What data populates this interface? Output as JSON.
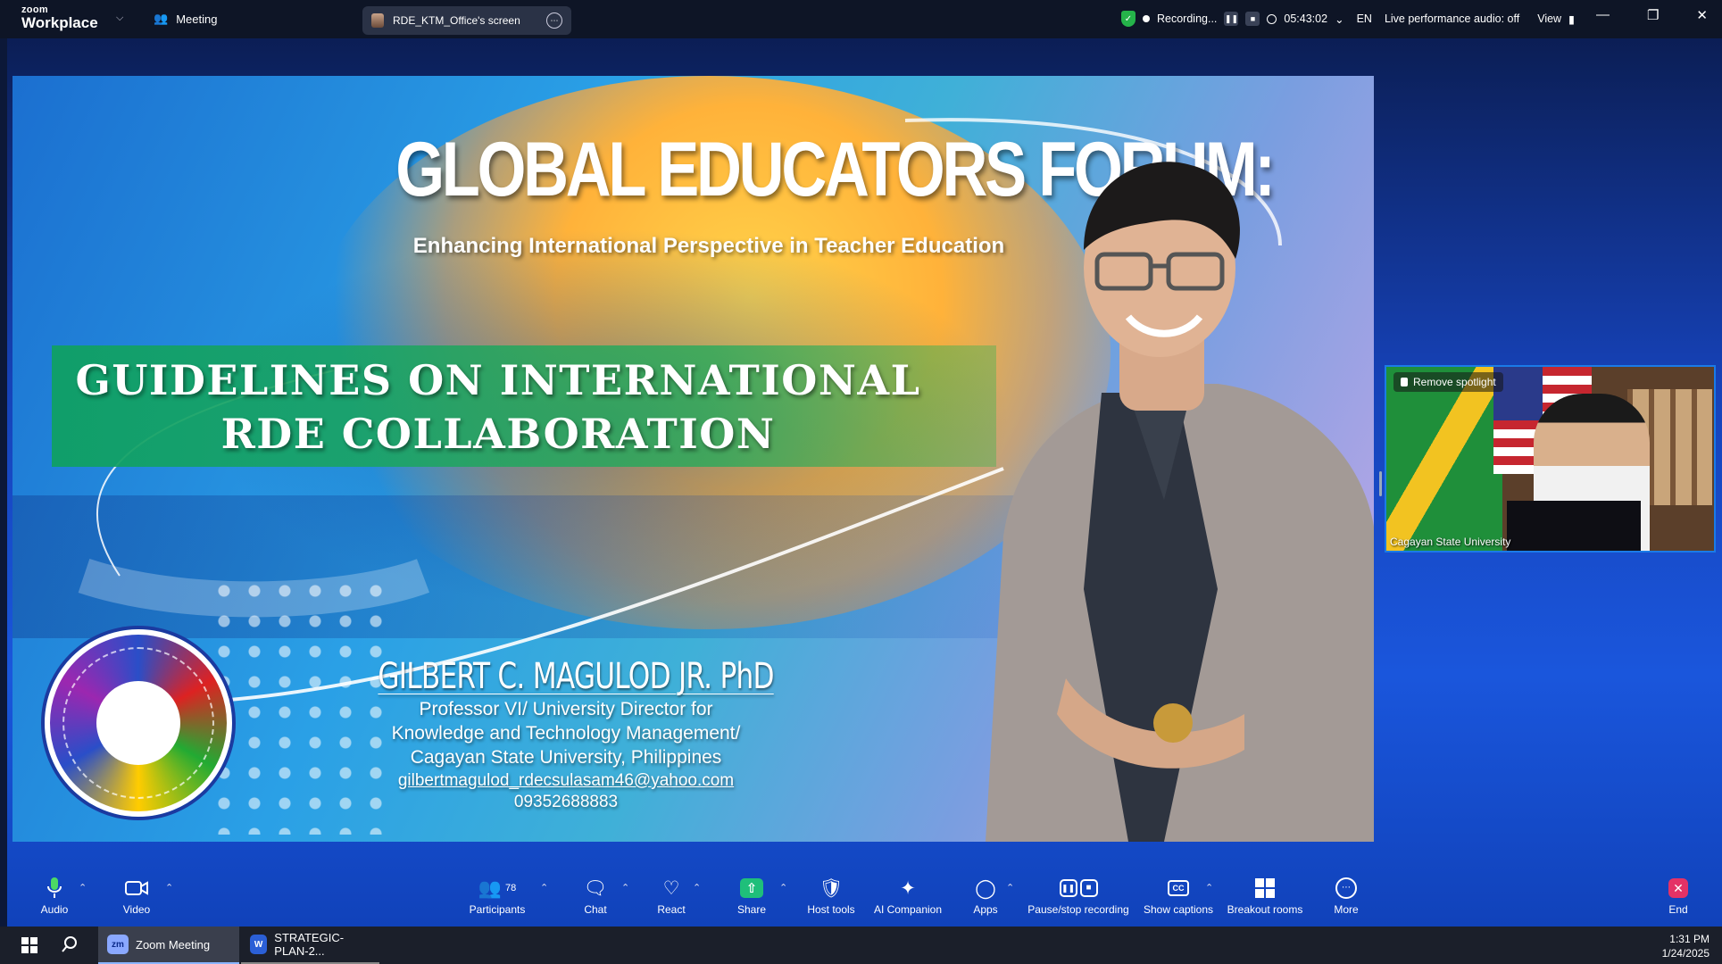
{
  "topbar": {
    "logo_line1": "zoom",
    "logo_line2": "Workplace",
    "meeting_label": "Meeting",
    "screen_share_label": "RDE_KTM_Office's screen",
    "recording_label": "Recording...",
    "timer": "05:43:02",
    "language": "EN",
    "performance": "Live performance audio: off",
    "view_label": "View"
  },
  "slide": {
    "title": "GLOBAL EDUCATORS FORUM:",
    "subtitle": "Enhancing International Perspective in Teacher Education",
    "topic_line1": "GUIDELINES ON INTERNATIONAL",
    "topic_line2": "RDE COLLABORATION",
    "speaker_name": "GILBERT C. MAGULOD JR. PhD",
    "speaker_role1": "Professor VI/ University Director for",
    "speaker_role2": "Knowledge and Technology Management/",
    "speaker_role3": "Cagayan State University, Philippines",
    "speaker_email": "gilbertmagulod_rdecsulasam46@yahoo.com",
    "speaker_phone": "09352688883"
  },
  "thumbnail": {
    "spotlight_label": "Remove spotlight",
    "participant_name": "Cagayan State University"
  },
  "toolbar": {
    "audio": "Audio",
    "video": "Video",
    "participants": "Participants",
    "participants_count": "78",
    "chat": "Chat",
    "react": "React",
    "share": "Share",
    "host_tools": "Host tools",
    "ai_companion": "AI Companion",
    "apps": "Apps",
    "pause_recording": "Pause/stop recording",
    "show_captions": "Show captions",
    "breakout_rooms": "Breakout rooms",
    "more": "More",
    "end": "End"
  },
  "taskbar": {
    "zoom_task": "Zoom Meeting",
    "word_task": "STRATEGIC-PLAN-2...",
    "time": "1:31 PM",
    "date": "1/24/2025"
  },
  "colors": {
    "accent": "#1a56dc",
    "share_green": "#1fbf7a",
    "end_red": "#e43266",
    "record_green": "#25b34a"
  }
}
